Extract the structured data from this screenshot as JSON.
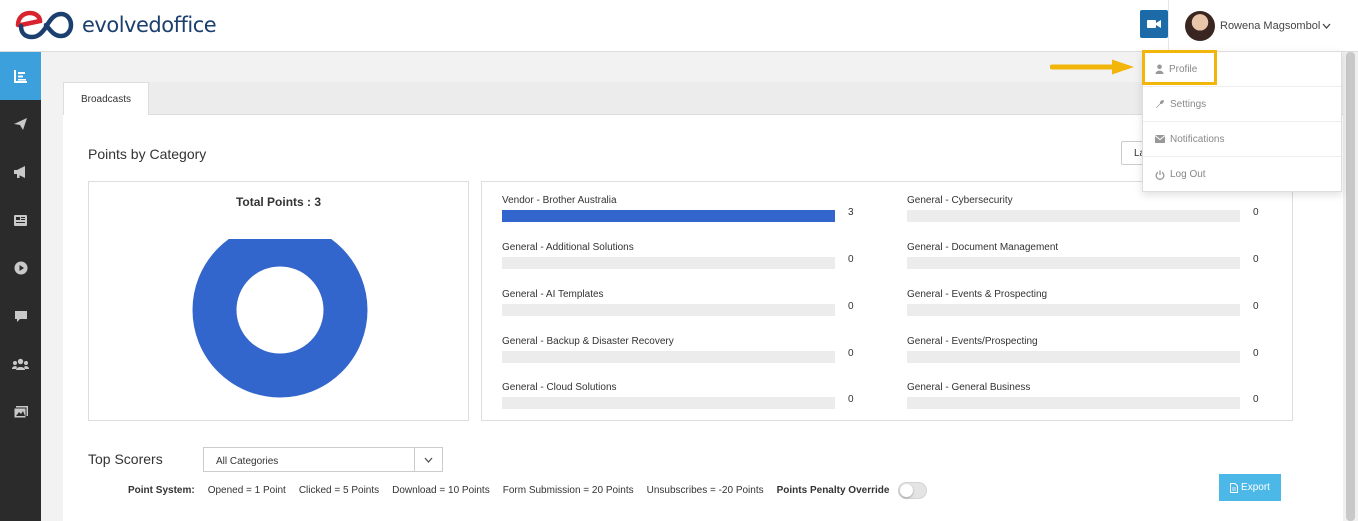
{
  "app": {
    "logo_text_1": "evolved",
    "logo_text_2": "office"
  },
  "header": {
    "user_name": "Rowena Magsombol",
    "video_icon": "video-camera-icon",
    "avatar_icon": "avatar"
  },
  "sidebar": {
    "items": [
      {
        "icon": "bar-chart-icon",
        "active": true
      },
      {
        "icon": "paper-plane-icon",
        "active": false
      },
      {
        "icon": "megaphone-icon",
        "active": false
      },
      {
        "icon": "newspaper-icon",
        "active": false
      },
      {
        "icon": "play-circle-icon",
        "active": false
      },
      {
        "icon": "comment-icon",
        "active": false
      },
      {
        "icon": "users-icon",
        "active": false
      },
      {
        "icon": "images-icon",
        "active": false
      }
    ]
  },
  "tabs": [
    {
      "label": "Broadcasts",
      "active": true
    }
  ],
  "points_by_category": {
    "title": "Points by Category",
    "range_button_label": "La",
    "donut_title": "Total Points : 3",
    "donut_color": "#3366cc"
  },
  "chart_data": {
    "type": "bar",
    "orientation": "horizontal",
    "max": 3,
    "categories": [
      "Vendor - Brother Australia",
      "General - Additional Solutions",
      "General - AI Templates",
      "General - Backup & Disaster Recovery",
      "General - Cloud Solutions",
      "General - Cybersecurity",
      "General - Document Management",
      "General - Events & Prospecting",
      "General - Events/Prospecting",
      "General - General Business"
    ],
    "values": [
      3,
      0,
      0,
      0,
      0,
      0,
      0,
      0,
      0,
      0
    ],
    "bar_color": "#3366cc",
    "track_color": "#ececec"
  },
  "top_scorers": {
    "title": "Top Scorers",
    "category_select_value": "All Categories",
    "point_system_label": "Point System:",
    "rules": [
      "Opened = 1 Point",
      "Clicked = 5 Points",
      "Download = 10 Points",
      "Form Submission = 20 Points",
      "Unsubscribes = -20 Points"
    ],
    "penalty_override_label": "Points Penalty Override",
    "penalty_override_on": false,
    "export_label": "Export"
  },
  "user_menu": {
    "items": [
      {
        "label": "Profile",
        "icon": "user-icon"
      },
      {
        "label": "Settings",
        "icon": "wrench-icon"
      },
      {
        "label": "Notifications",
        "icon": "envelope-icon"
      },
      {
        "label": "Log Out",
        "icon": "power-icon"
      }
    ],
    "highlight_color": "#f2b50a"
  }
}
